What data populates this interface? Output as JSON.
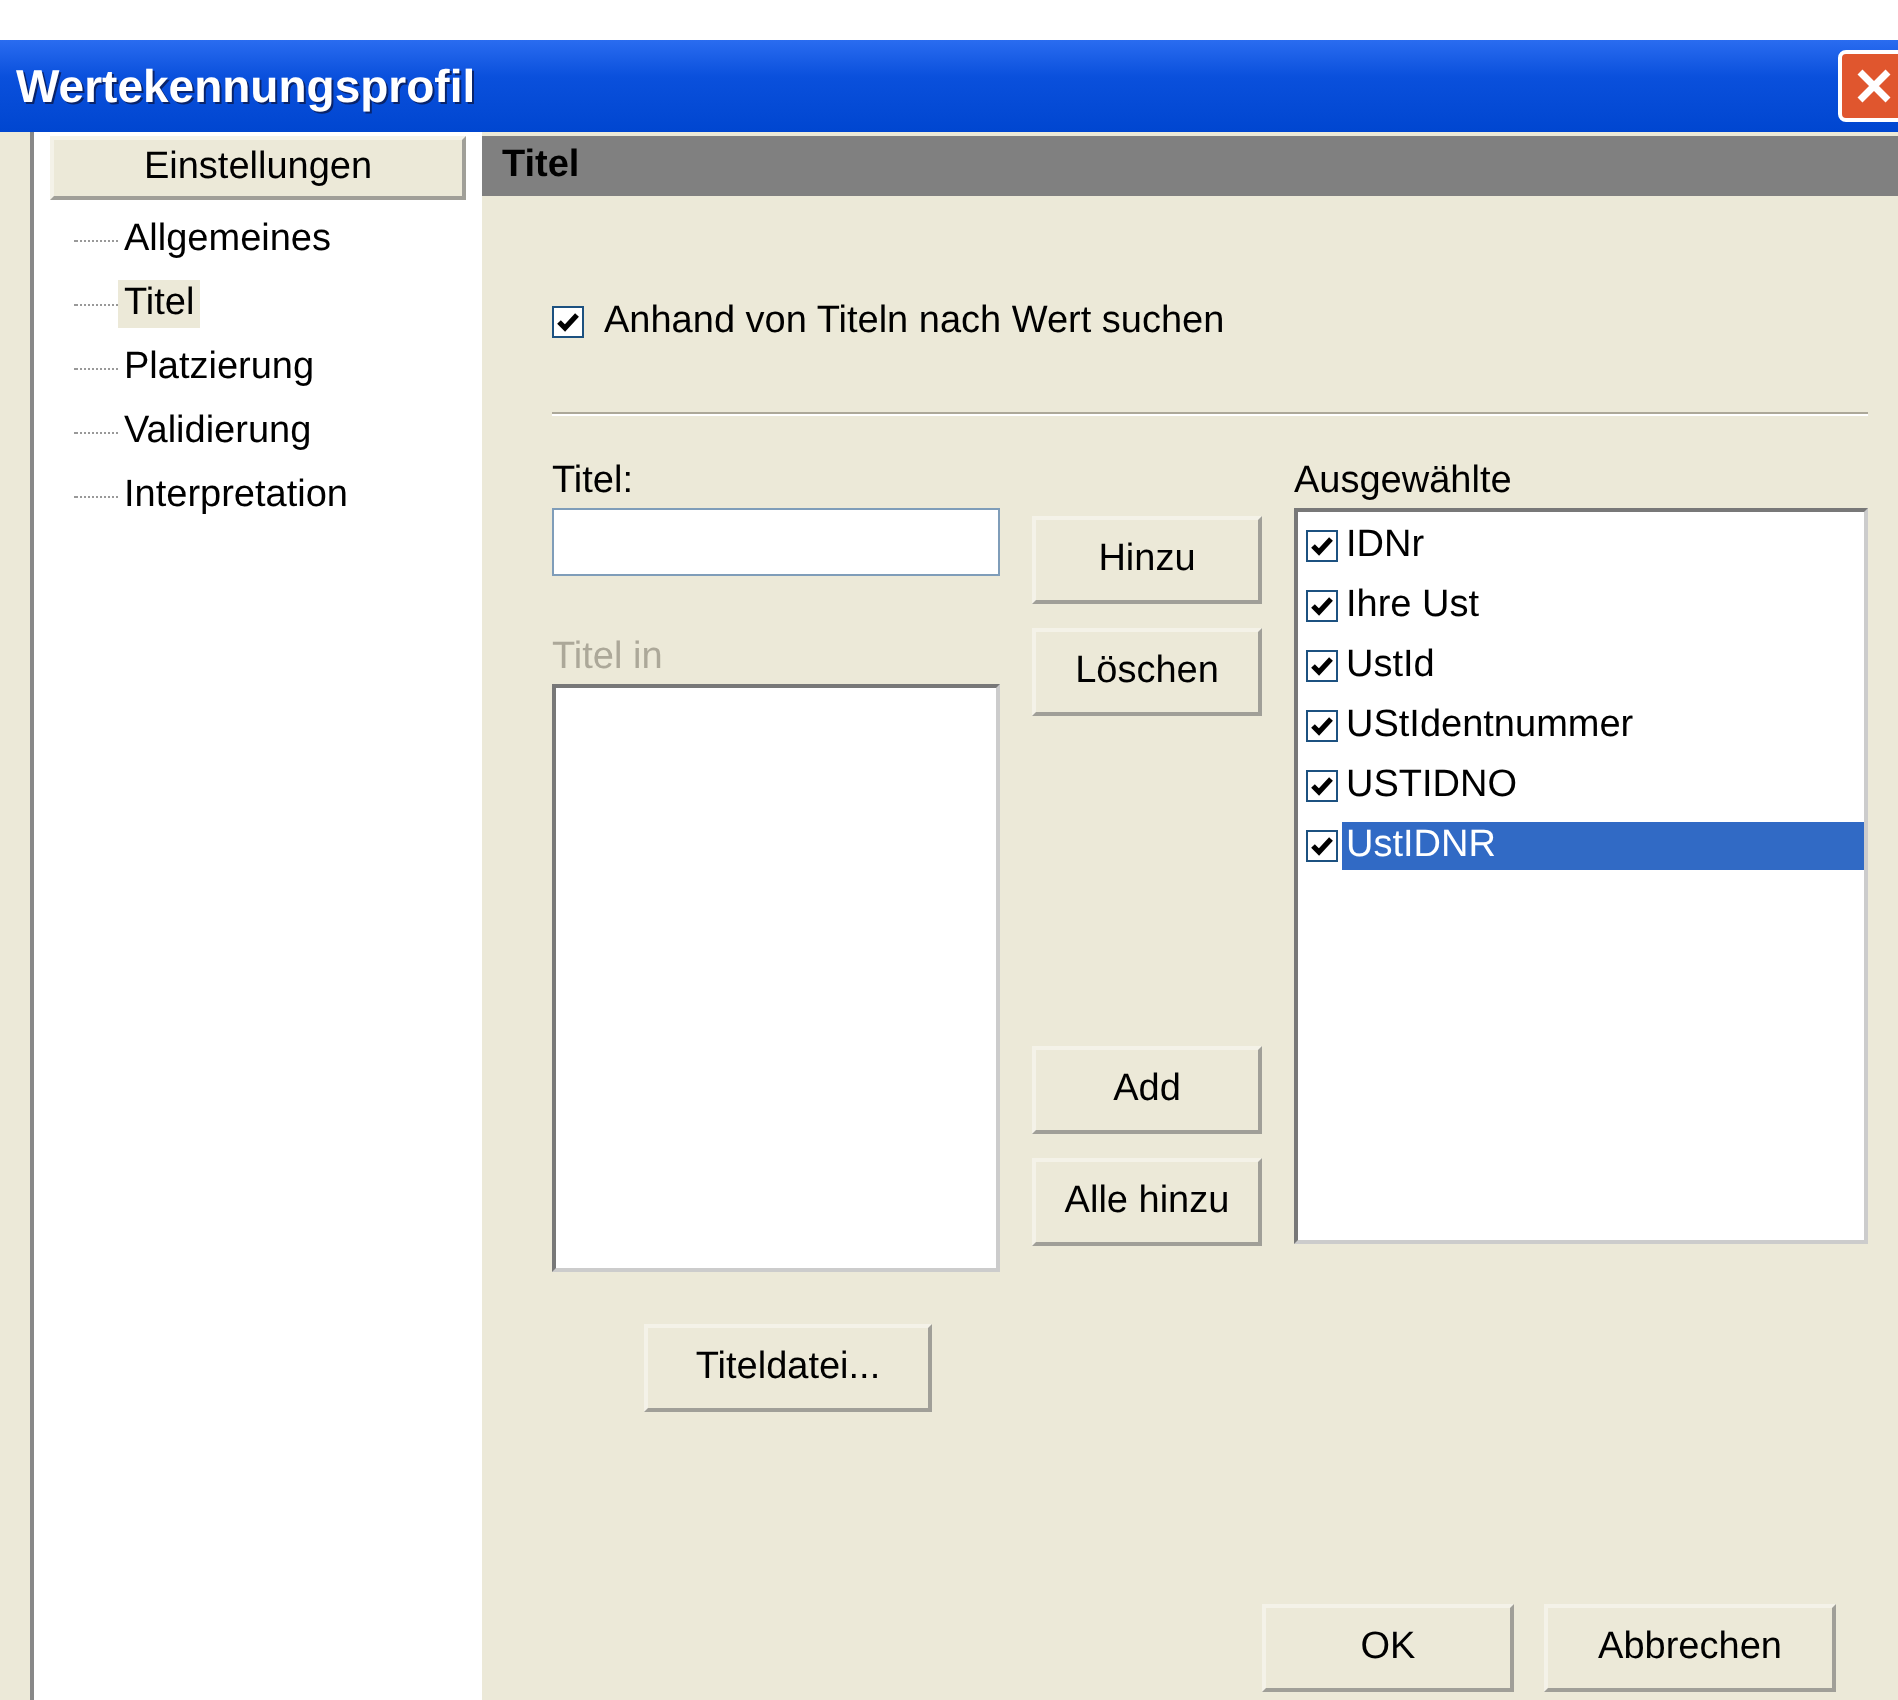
{
  "window": {
    "title": "Wertekennungsprofil"
  },
  "sidebar": {
    "header": "Einstellungen",
    "items": [
      {
        "label": "Allgemeines",
        "selected": false
      },
      {
        "label": "Titel",
        "selected": true
      },
      {
        "label": "Platzierung",
        "selected": false
      },
      {
        "label": "Validierung",
        "selected": false
      },
      {
        "label": "Interpretation",
        "selected": false
      }
    ]
  },
  "panel": {
    "header": "Titel",
    "search_by_title": {
      "label": "Anhand von Titeln nach Wert suchen",
      "checked": true
    },
    "title_field": {
      "label": "Titel:"
    },
    "titles_in": {
      "label": "Titel in",
      "disabled": true
    },
    "middle_buttons": [
      {
        "label": "Hinzu"
      },
      {
        "label": "Löschen"
      }
    ],
    "lower_buttons": [
      {
        "label": "Add"
      },
      {
        "label": "Alle hinzu"
      }
    ],
    "file_button": {
      "label": "Titeldatei..."
    },
    "selected_list": {
      "label": "Ausgewählte",
      "items": [
        {
          "label": "IDNr",
          "checked": true,
          "selected": false
        },
        {
          "label": "Ihre Ust",
          "checked": true,
          "selected": false
        },
        {
          "label": "UstId",
          "checked": true,
          "selected": false
        },
        {
          "label": "UStIdentnummer",
          "checked": true,
          "selected": false
        },
        {
          "label": "USTIDNO",
          "checked": true,
          "selected": false
        },
        {
          "label": "UstIDNR",
          "checked": true,
          "selected": true
        }
      ]
    }
  },
  "buttons": [
    {
      "label": "OK"
    },
    {
      "label": "Abbrechen"
    }
  ]
}
